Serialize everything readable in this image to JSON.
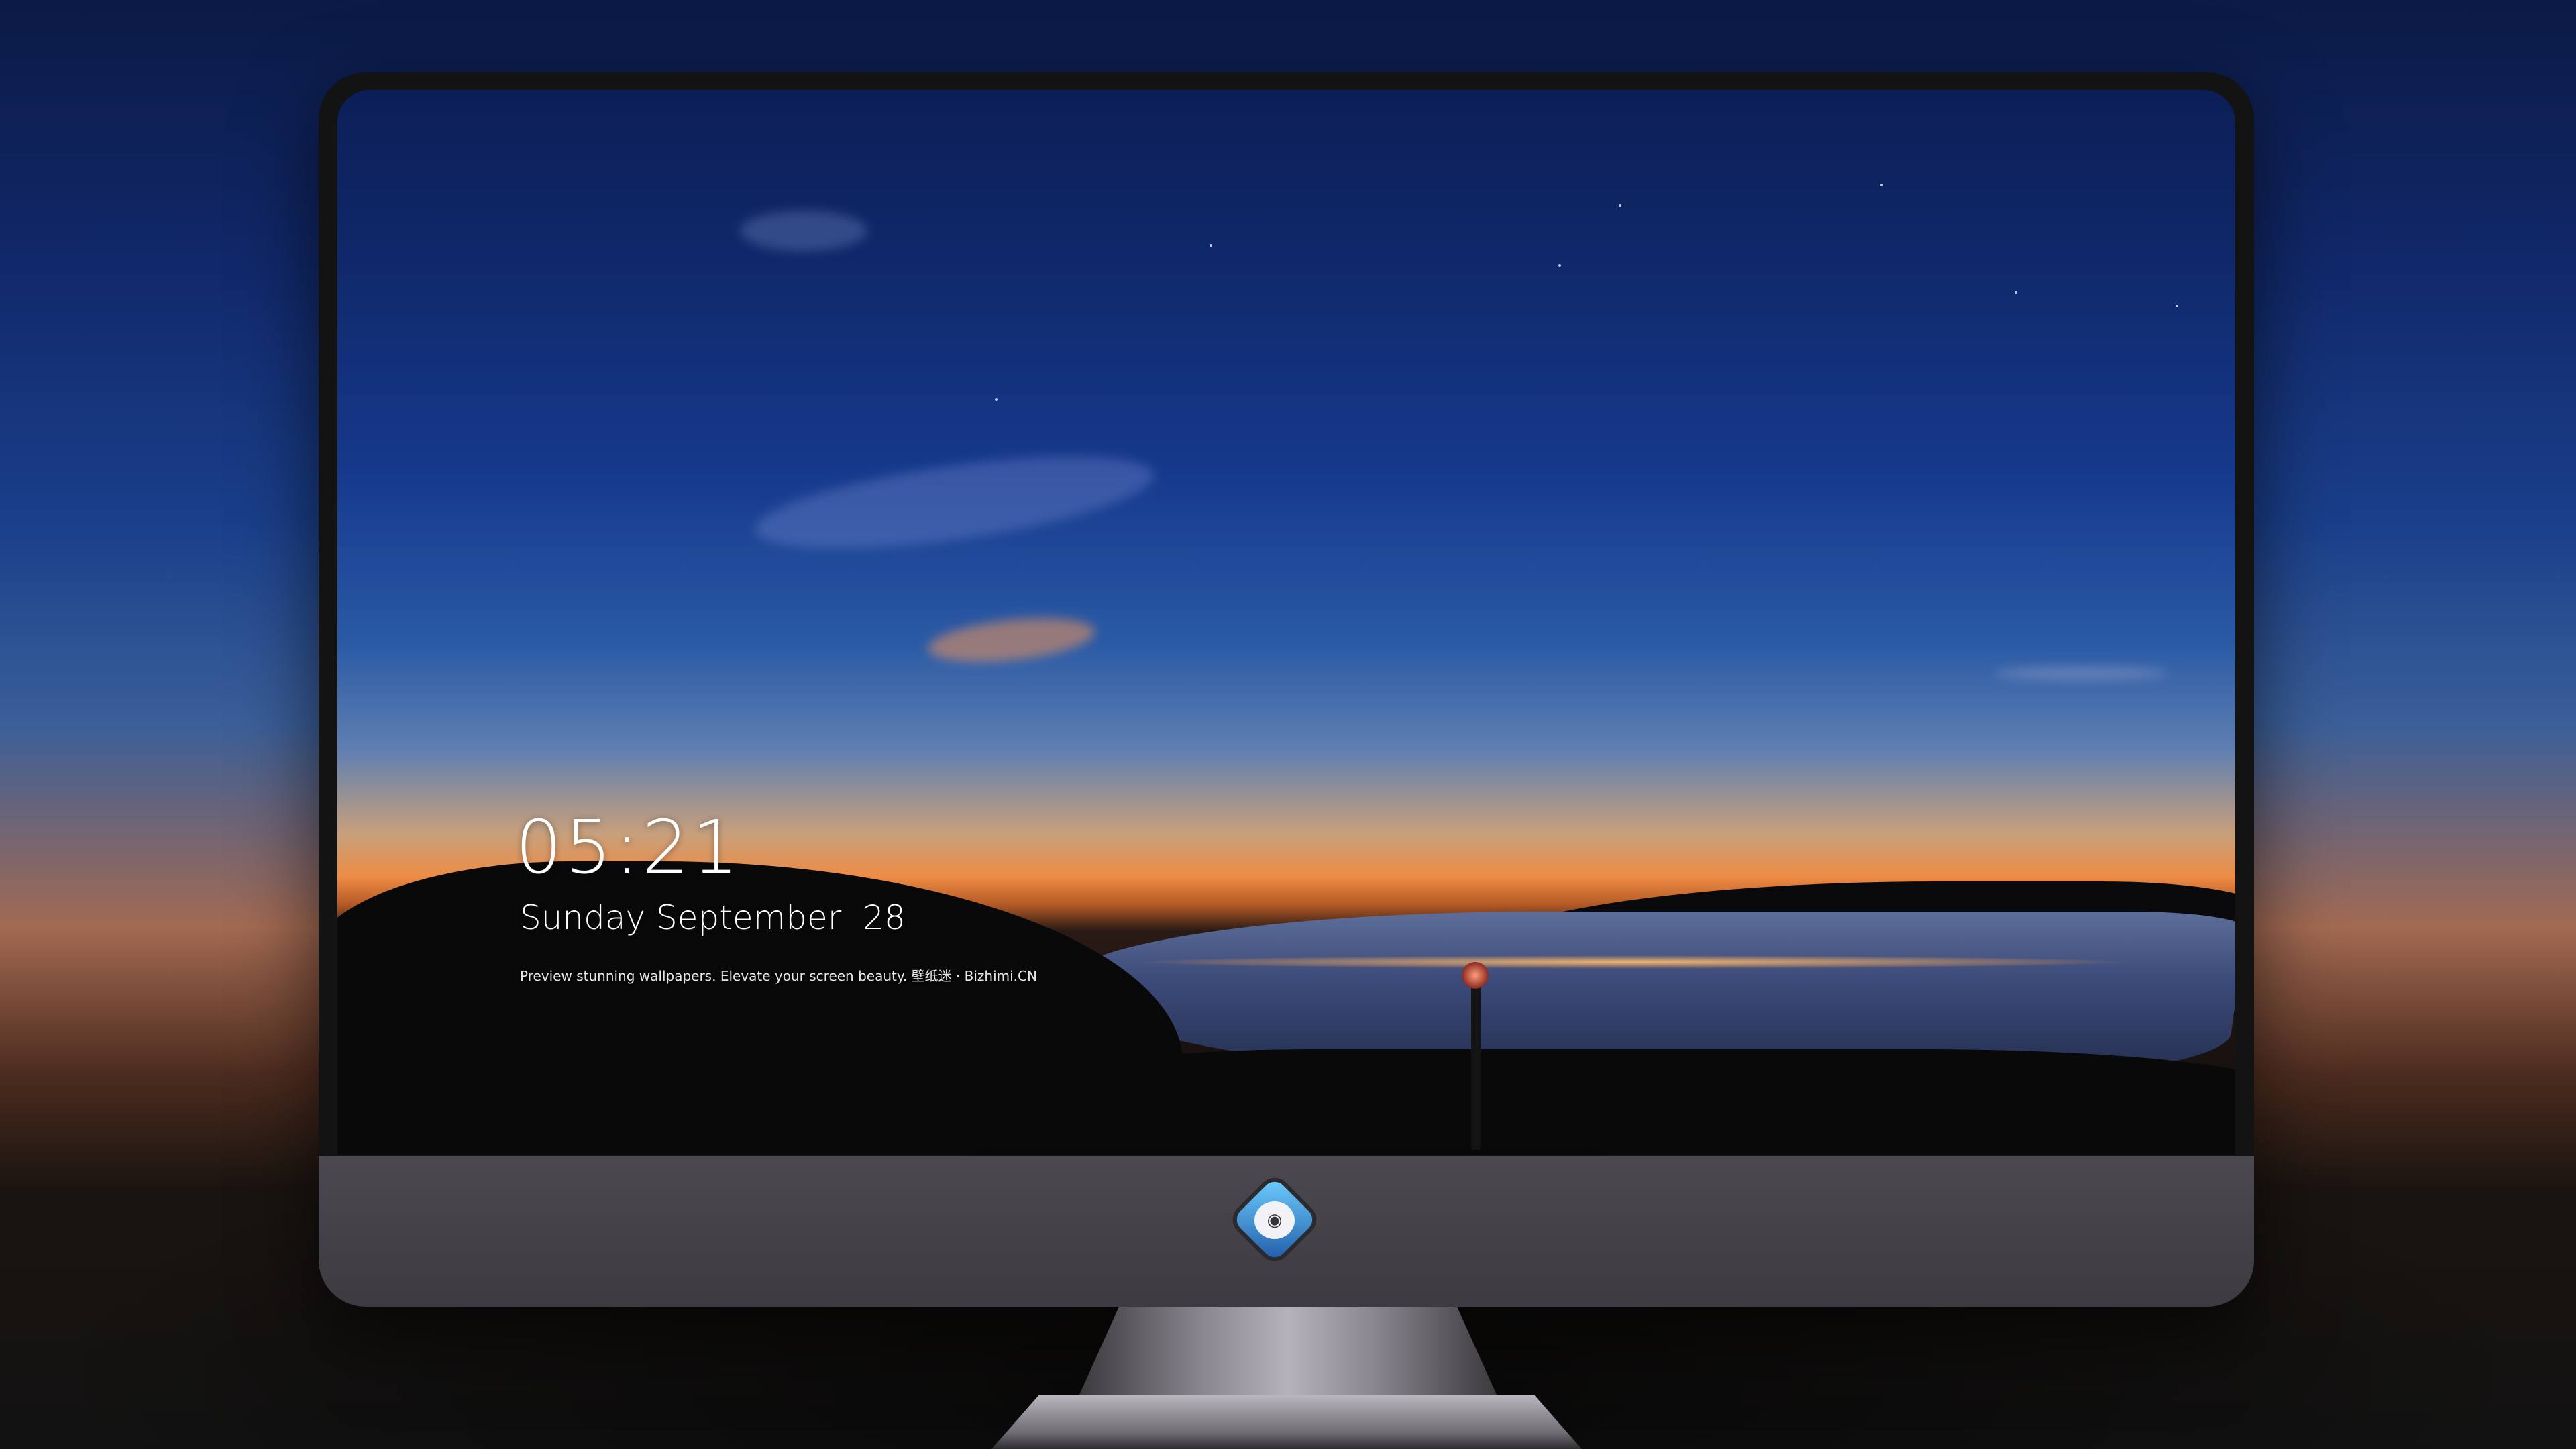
{
  "lockscreen": {
    "time": "05:21",
    "date": "Sunday September  28",
    "tagline": "Preview stunning wallpapers. Elevate your screen beauty. 壁纸迷 · Bizhimi.CN"
  },
  "dock": {
    "icons": [
      {
        "name": "messages-icon",
        "glyph": "💬"
      },
      {
        "name": "weather-icon",
        "glyph": "☁"
      },
      {
        "name": "clock-icon",
        "glyph": "🕐"
      },
      {
        "name": "maps-icon",
        "glyph": "⌖"
      },
      {
        "name": "clips-icon",
        "glyph": "🎬"
      },
      {
        "name": "notes-icon",
        "glyph": ""
      },
      {
        "name": "photos-icon",
        "glyph": "▦"
      },
      {
        "name": "music-icon",
        "glyph": "♫"
      },
      {
        "name": "app-store-icon",
        "glyph": "Ⓐ"
      },
      {
        "name": "camera-icon",
        "glyph": "📷"
      }
    ]
  },
  "colors": {
    "sky_top": "#0c1e57",
    "horizon": "#ee8b44",
    "chin": "#4c4850",
    "dock_bg": "#26262c"
  }
}
